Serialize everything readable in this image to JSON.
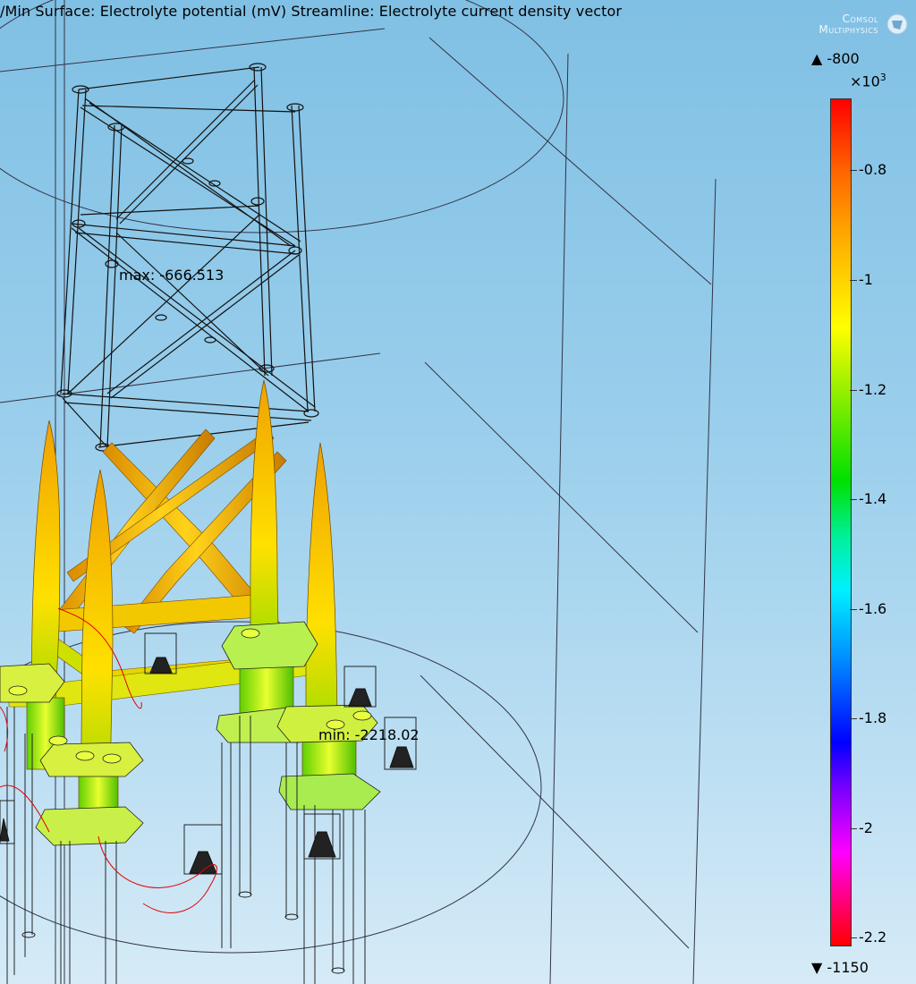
{
  "plot": {
    "title": "/Min Surface: Electrolyte potential (mV)  Streamline: Electrolyte current density vector",
    "max_label": "max: -666.513",
    "min_label": "min: -2218.02"
  },
  "logo": {
    "line1": "Comsol",
    "line2": "Multiphysics"
  },
  "colorbar": {
    "top_label": "▲ -800",
    "multiplier_base": "×10",
    "multiplier_exp": "3",
    "bottom_label": "▼ -1150",
    "ticks": [
      "-0.8",
      "-1",
      "-1.2",
      "-1.4",
      "-1.6",
      "-1.8",
      "-2",
      "-2.2"
    ],
    "colors": [
      "#ff0000",
      "#ffff00",
      "#00e000",
      "#00f0ff",
      "#0000ff",
      "#ff00ff",
      "#ff0000"
    ]
  }
}
